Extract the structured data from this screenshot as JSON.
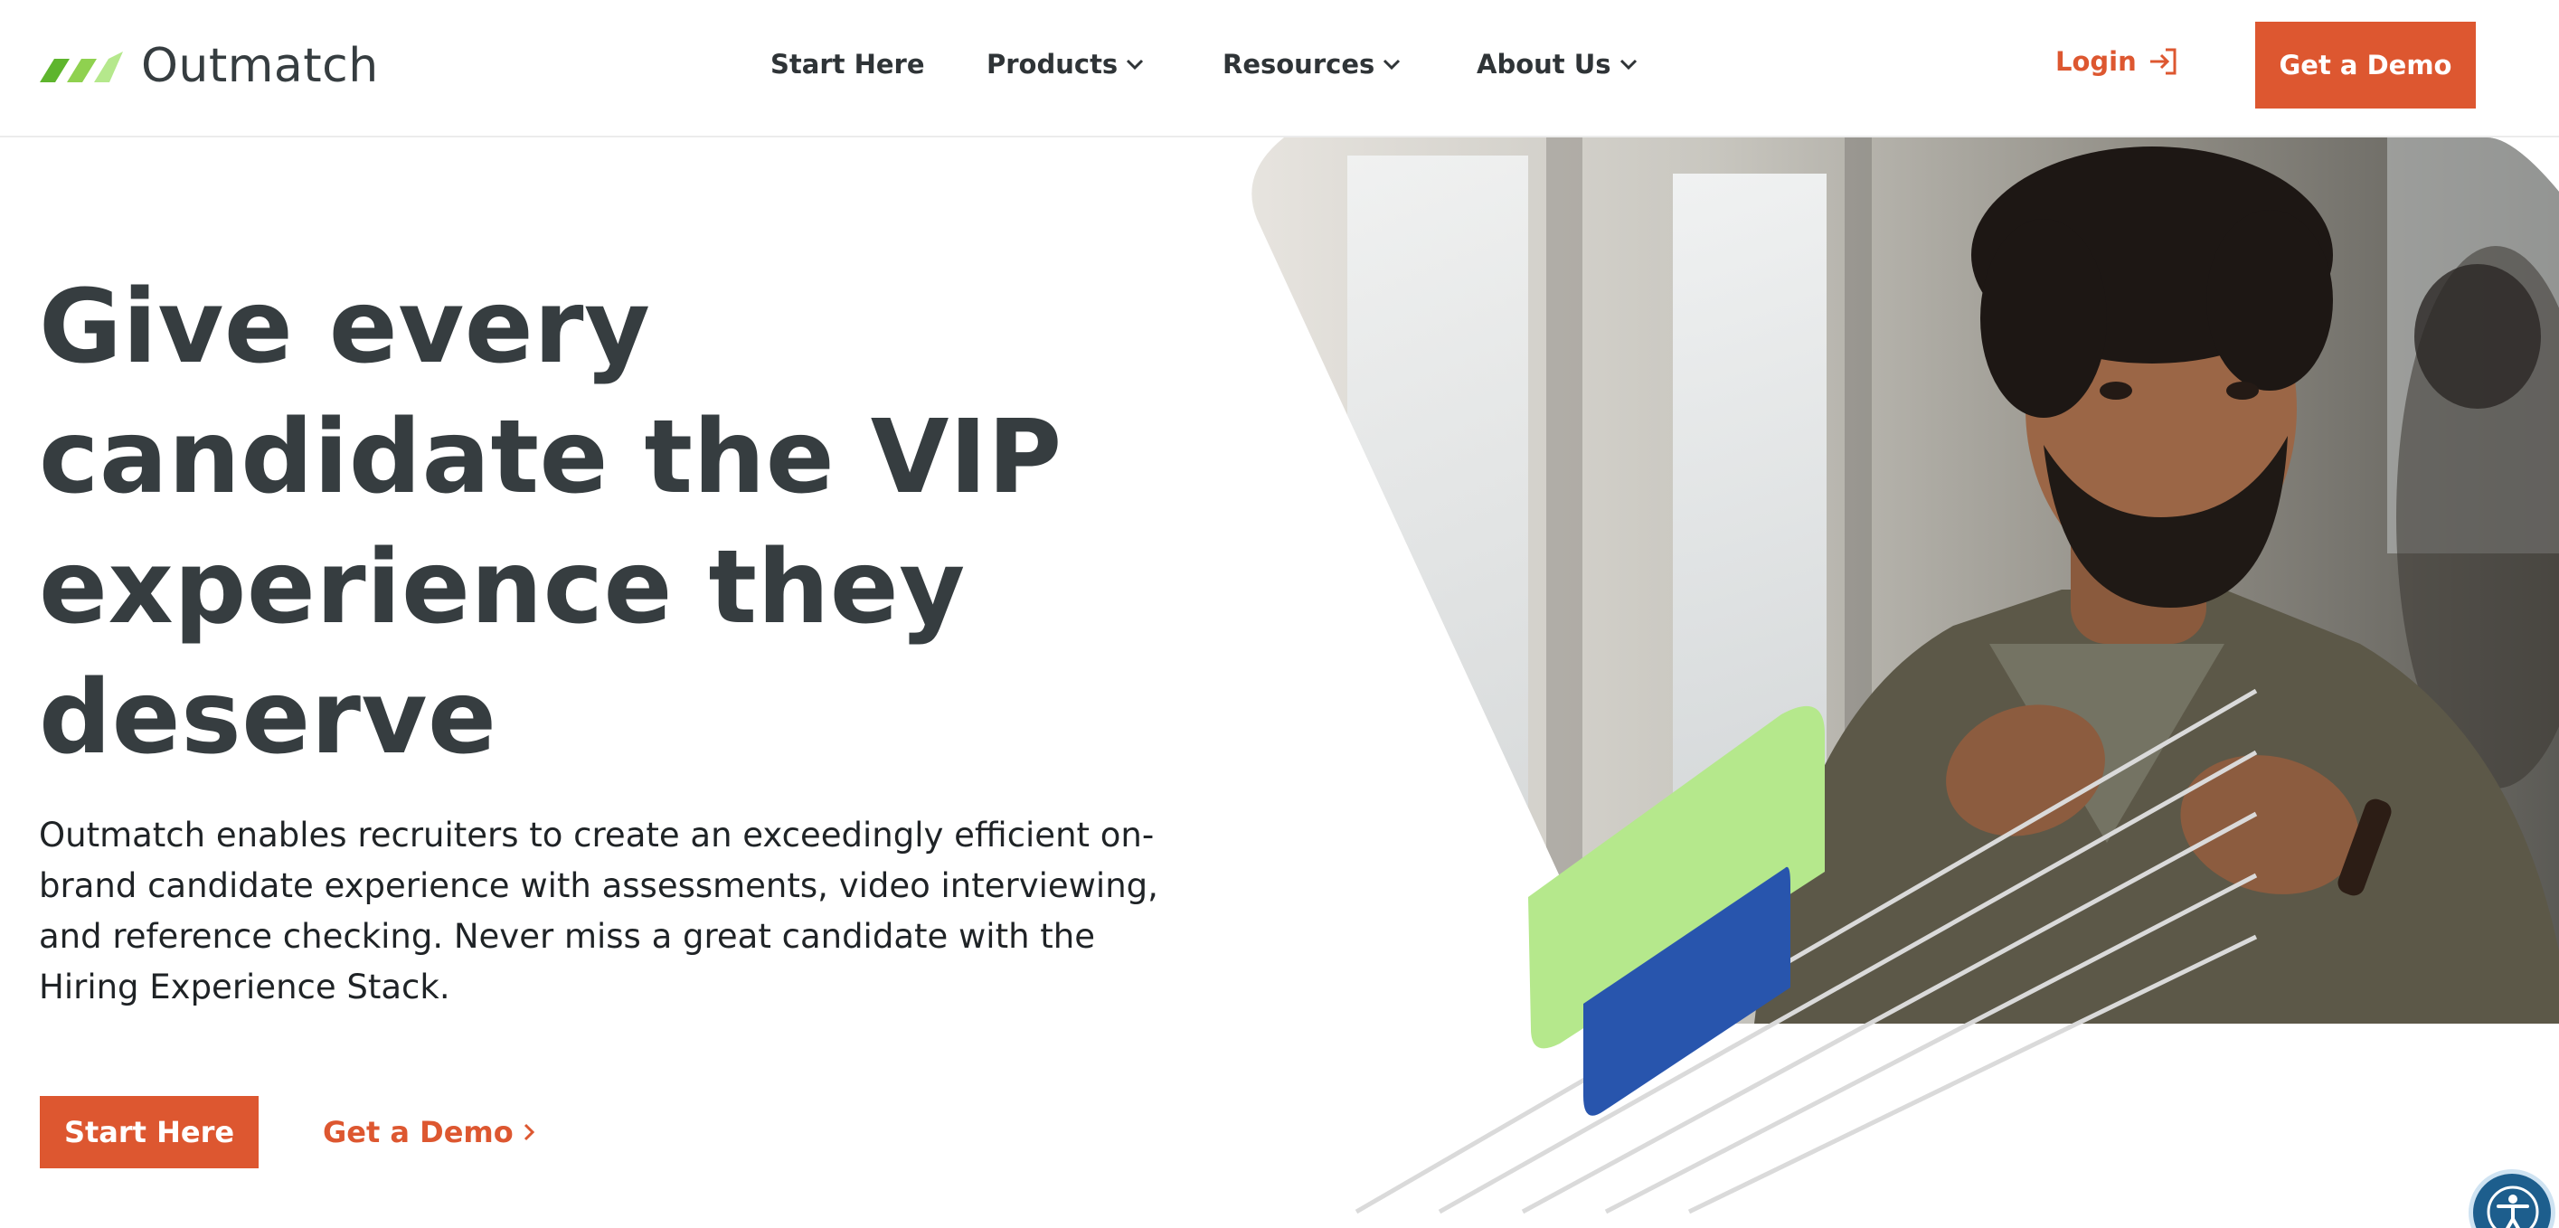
{
  "brand": {
    "name": "Outmatch",
    "colors": {
      "primary_orange": "#dd5730",
      "heading_gray": "#363d40",
      "accent_green": "#b5e88c",
      "accent_blue": "#2855ad",
      "logo_green_light": "#a8e26d",
      "logo_green_dark": "#5eb52d"
    }
  },
  "nav": {
    "items": [
      {
        "label": "Start Here",
        "has_dropdown": false
      },
      {
        "label": "Products",
        "has_dropdown": true
      },
      {
        "label": "Resources",
        "has_dropdown": true
      },
      {
        "label": "About Us",
        "has_dropdown": true
      }
    ],
    "login_label": "Login",
    "login_icon": "login-arrow-icon",
    "cta_label": "Get a Demo"
  },
  "hero": {
    "title_lines": [
      "Give every",
      "candidate the VIP",
      "experience they",
      "deserve"
    ],
    "subtitle": "Outmatch enables recruiters to create an exceedingly efficient on-brand candidate experience with assessments, video interviewing, and reference checking. Never miss a great candidate with the Hiring Experience Stack.",
    "primary_button": "Start Here",
    "secondary_link": "Get a Demo",
    "secondary_link_icon": "chevron-right-icon",
    "image_icon": "photo-man-speaking"
  },
  "accessibility": {
    "icon": "accessibility-icon"
  }
}
